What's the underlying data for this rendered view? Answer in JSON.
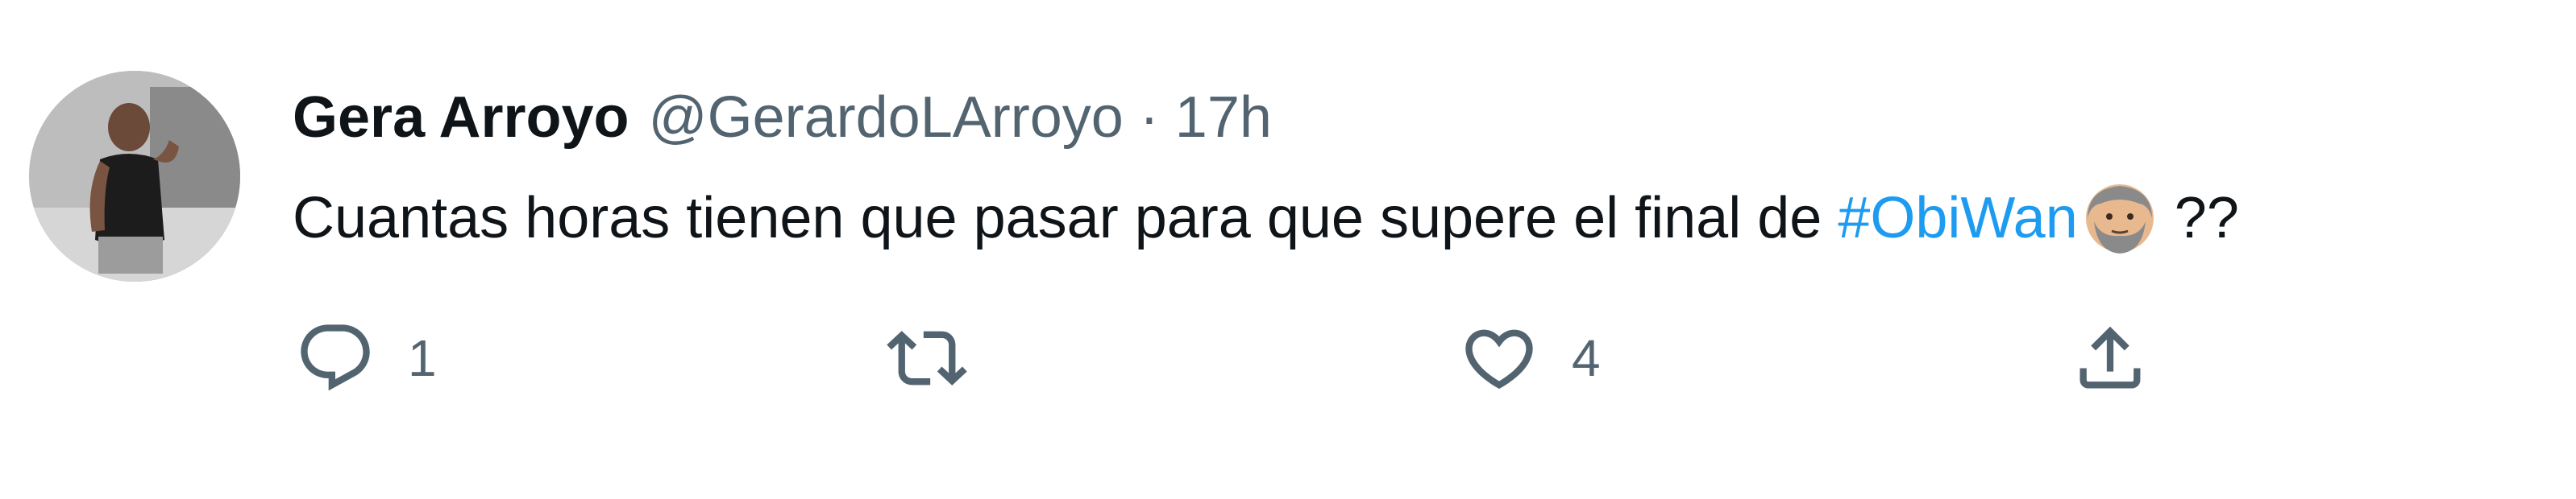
{
  "tweet": {
    "display_name": "Gera Arroyo",
    "handle": "@GerardoLArroyo",
    "separator": "·",
    "time": "17h",
    "text_before": "Cuantas horas tienen que pasar para que supere el final de",
    "hashtag": "#ObiWan",
    "emoji": "old-man-bearded-face-emoji",
    "text_after": "??"
  },
  "actions": {
    "reply": {
      "icon": "reply-icon",
      "count": "1"
    },
    "retweet": {
      "icon": "retweet-icon",
      "count": ""
    },
    "like": {
      "icon": "heart-icon",
      "count": "4"
    },
    "share": {
      "icon": "share-icon"
    }
  },
  "colors": {
    "text": "#0f1419",
    "secondary": "#536471",
    "link": "#1d9bf0"
  }
}
